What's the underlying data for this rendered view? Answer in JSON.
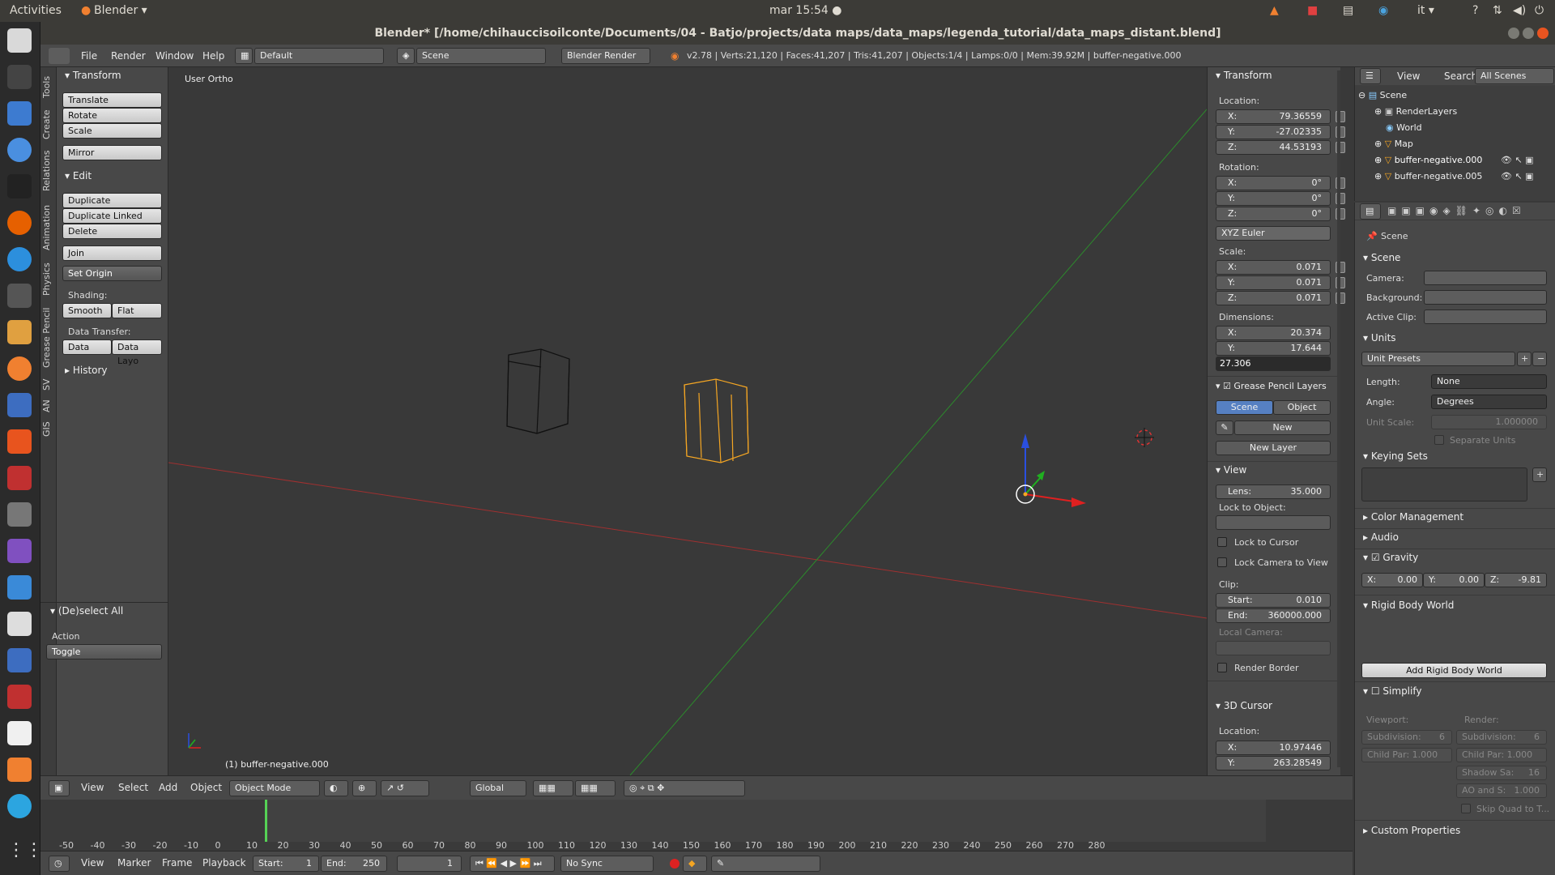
{
  "topbar": {
    "activities": "Activities",
    "app": "Blender ▾",
    "clock": "mar 15:54 ●",
    "lang": "it ▾",
    "help": "?"
  },
  "window": {
    "title": "Blender* [/home/chihauccisoilconte/Documents/04 - Batjo/projects/data maps/data_maps/legenda_tutorial/data_maps_distant.blend]"
  },
  "info": {
    "menus": [
      "File",
      "Render",
      "Window",
      "Help"
    ],
    "layout": "Default",
    "scene": "Scene",
    "engine": "Blender Render",
    "stats": "v2.78 | Verts:21,120 | Faces:41,207 | Tris:41,207 | Objects:1/4 | Lamps:0/0 | Mem:39.92M | buffer-negative.000"
  },
  "tabs": [
    "Tools",
    "Create",
    "Relations",
    "Animation",
    "Physics",
    "Grease Pencil",
    "SV",
    "AN",
    "GIS"
  ],
  "tools": {
    "transform_header": "Transform",
    "translate": "Translate",
    "rotate": "Rotate",
    "scale": "Scale",
    "mirror": "Mirror",
    "edit_header": "Edit",
    "duplicate": "Duplicate",
    "duplicate_linked": "Duplicate Linked",
    "delete": "Delete",
    "join": "Join",
    "set_origin": "Set Origin",
    "shading": "Shading:",
    "smooth": "Smooth",
    "flat": "Flat",
    "data_transfer": "Data Transfer:",
    "data": "Data",
    "data_layo": "Data Layo",
    "history": "History"
  },
  "operator": {
    "title": "(De)select All",
    "action_label": "Action",
    "action_value": "Toggle"
  },
  "viewport": {
    "view_name": "User Ortho",
    "object_name": "(1) buffer-negative.000"
  },
  "npanel": {
    "transform": "Transform",
    "location": "Location:",
    "loc": [
      {
        "k": "X:",
        "v": "79.36559"
      },
      {
        "k": "Y:",
        "v": "-27.02335"
      },
      {
        "k": "Z:",
        "v": "44.53193"
      }
    ],
    "rotation": "Rotation:",
    "rot": [
      {
        "k": "X:",
        "v": "0°"
      },
      {
        "k": "Y:",
        "v": "0°"
      },
      {
        "k": "Z:",
        "v": "0°"
      }
    ],
    "euler": "XYZ Euler",
    "scale_label": "Scale:",
    "scl": [
      {
        "k": "X:",
        "v": "0.071"
      },
      {
        "k": "Y:",
        "v": "0.071"
      },
      {
        "k": "Z:",
        "v": "0.071"
      }
    ],
    "dimensions": "Dimensions:",
    "dim": [
      {
        "k": "X:",
        "v": "20.374"
      },
      {
        "k": "Y:",
        "v": "17.644"
      }
    ],
    "dim_editing": "27.306",
    "gp_layers": "Grease Pencil Layers",
    "gp_scene": "Scene",
    "gp_object": "Object",
    "gp_new": "New",
    "gp_new_layer": "New Layer",
    "view": "View",
    "lens_k": "Lens:",
    "lens_v": "35.000",
    "lock_to_object": "Lock to Object:",
    "lock_to_cursor": "Lock to Cursor",
    "lock_cam": "Lock Camera to View",
    "clip": "Clip:",
    "clip_start_k": "Start:",
    "clip_start_v": "0.010",
    "clip_end_k": "End:",
    "clip_end_v": "360000.000",
    "local_camera": "Local Camera:",
    "render_border": "Render Border",
    "cursor": "3D Cursor",
    "cursor_location": "Location:",
    "cursor_loc": [
      {
        "k": "X:",
        "v": "10.97446"
      },
      {
        "k": "Y:",
        "v": "263.28549"
      }
    ]
  },
  "vtoolbar": {
    "menus": [
      "View",
      "Select",
      "Add",
      "Object"
    ],
    "mode": "Object Mode",
    "orientation": "Global"
  },
  "timeline": {
    "ticks": [
      "-50",
      "-40",
      "-30",
      "-20",
      "-10",
      "0",
      "10",
      "20",
      "30",
      "40",
      "50",
      "60",
      "70",
      "80",
      "90",
      "100",
      "110",
      "120",
      "130",
      "140",
      "150",
      "160",
      "170",
      "180",
      "190",
      "200",
      "210",
      "220",
      "230",
      "240",
      "250",
      "260",
      "270",
      "280"
    ],
    "menus": [
      "View",
      "Marker",
      "Frame",
      "Playback"
    ],
    "start": "Start:",
    "start_v": "1",
    "end": "End:",
    "end_v": "250",
    "current": "1",
    "sync": "No Sync"
  },
  "outliner": {
    "menus": [
      "View",
      "Search"
    ],
    "filter": "All Scenes",
    "items": [
      "Scene",
      "RenderLayers",
      "World",
      "Map",
      "buffer-negative.000",
      "buffer-negative.005"
    ]
  },
  "props": {
    "crumb": "Scene",
    "scene_header": "Scene",
    "camera": "Camera:",
    "background": "Background:",
    "active_clip": "Active Clip:",
    "units": "Units",
    "unit_presets": "Unit Presets",
    "length": "Length:",
    "length_v": "None",
    "angle": "Angle:",
    "angle_v": "Degrees",
    "unit_scale": "Unit Scale:",
    "unit_scale_v": "1.000000",
    "separate_units": "Separate Units",
    "keying_sets": "Keying Sets",
    "color_mgmt": "Color Management",
    "audio": "Audio",
    "gravity": "Gravity",
    "gx": "X:",
    "gx_v": "0.00",
    "gy": "Y:",
    "gy_v": "0.00",
    "gz": "Z:",
    "gz_v": "-9.81",
    "rigid": "Rigid Body World",
    "add_rigid": "Add Rigid Body World",
    "simplify": "Simplify",
    "viewport": "Viewport:",
    "render": "Render:",
    "subdiv": "Subdivision:",
    "subdiv_v": "6",
    "childpar": "Child Par:",
    "childpar_v": "1.000",
    "shadow": "Shadow Sa:",
    "shadow_v": "16",
    "ao": "AO and S:",
    "ao_v": "1.000",
    "skip_quad": "Skip Quad to T...",
    "custom_props": "Custom Properties"
  },
  "colors": {
    "accent": "#5680c2",
    "selected": "#f5a623",
    "x_axis": "#c83232",
    "y_axis": "#2f9a2f"
  }
}
